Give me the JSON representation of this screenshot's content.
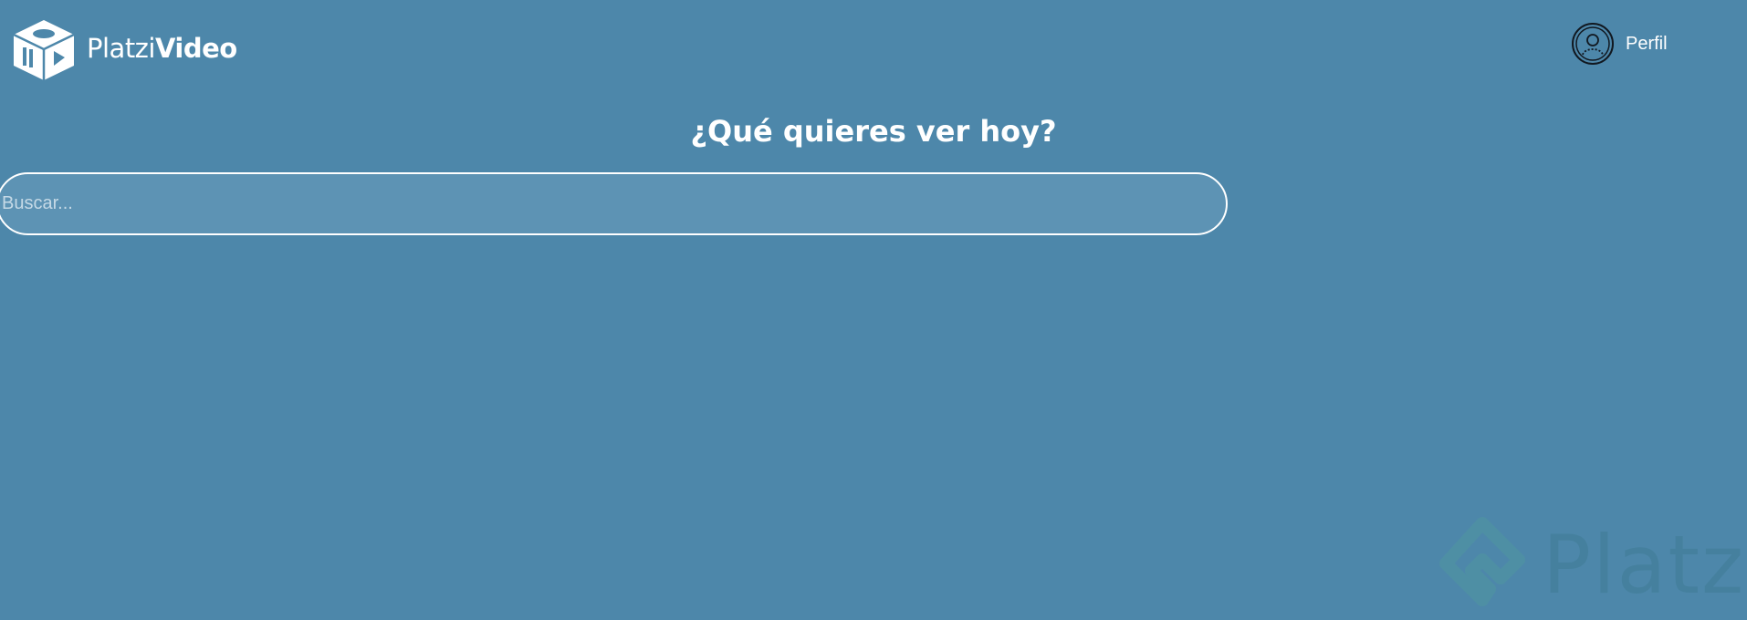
{
  "header": {
    "logo": {
      "text_light": "Platzi",
      "text_bold": "Video",
      "icon": "platzi-video-cube-icon"
    },
    "profile": {
      "label": "Perfil",
      "icon": "user-avatar-icon"
    }
  },
  "main": {
    "title": "¿Qué quieres ver hoy?",
    "search": {
      "placeholder": "Buscar...",
      "value": ""
    }
  },
  "watermark": {
    "text": "Platzi",
    "icon": "platzi-logo-icon"
  },
  "colors": {
    "background": "#4d87aa",
    "search_fill": "#5d93b4",
    "text": "#ffffff",
    "watermark": "#3f7c95"
  }
}
